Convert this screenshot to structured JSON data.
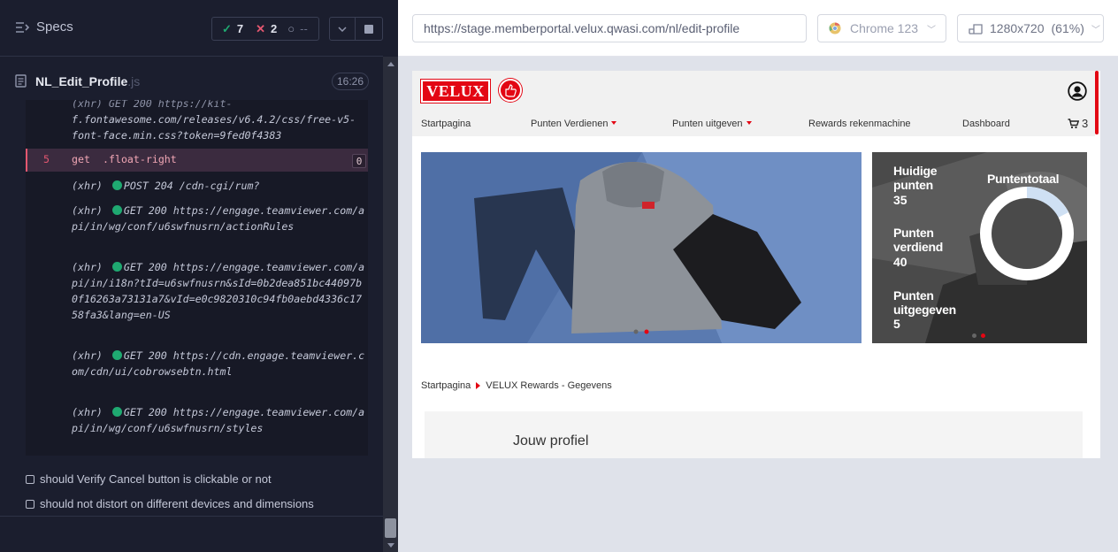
{
  "runner": {
    "title": "Specs",
    "stats": {
      "passed": "7",
      "failed": "2",
      "pending": "--"
    },
    "file": {
      "name": "NL_Edit_Profile",
      "ext": ".js",
      "duration": "16:26"
    },
    "log": {
      "top_line": "(xhr)  GET 200 https://kit-",
      "top_url": "f.fontawesome.com/releases/v6.4.2/css/free-v5-font-face.min.css?token=9fed0f4383",
      "command": {
        "number": "5",
        "name": "get",
        "selector": ".float-right",
        "count": "0"
      },
      "requests": [
        {
          "tag": "(xhr)",
          "method": "POST 204",
          "url": "/cdn-cgi/rum?"
        },
        {
          "tag": "(xhr)",
          "method": "GET 200",
          "url": "https://engage.teamviewer.com/api/in/wg/conf/u6swfnusrn/actionRules"
        },
        {
          "tag": "(xhr)",
          "method": "GET 200",
          "url": "https://engage.teamviewer.com/api/in/i18n?tId=u6swfnusrn&sId=0b2dea851bc44097b0f16263a73131a7&vId=e0c9820310c94fb0aebd4336c1758fa3&lang=en-US"
        },
        {
          "tag": "(xhr)",
          "method": "GET 200",
          "url": "https://cdn.engage.teamviewer.com/cdn/ui/cobrowsebtn.html"
        },
        {
          "tag": "(xhr)",
          "method": "GET 200",
          "url": "https://engage.teamviewer.com/api/in/wg/conf/u6swfnusrn/styles"
        }
      ]
    },
    "tests": [
      "should Verify Cancel button is clickable or not",
      "should not distort on different devices and dimensions"
    ]
  },
  "toolbar": {
    "url": "https://stage.memberportal.velux.qwasi.com/nl/edit-profile",
    "browser": "Chrome 123",
    "viewport": "1280x720",
    "zoom": "(61%)"
  },
  "site": {
    "logo": "VELUX",
    "nav": [
      "Startpagina",
      "Punten Verdienen",
      "Punten uitgeven",
      "Rewards rekenmachine",
      "Dashboard"
    ],
    "cart_count": "3",
    "stats": {
      "current_label": "Huidige punten",
      "current_value": "35",
      "earned_label": "Punten verdiend",
      "earned_value": "40",
      "spent_label": "Punten uitgegeven",
      "spent_value": "5",
      "total_label": "Puntentotaal"
    },
    "breadcrumb": {
      "home": "Startpagina",
      "current": "VELUX Rewards - Gegevens"
    },
    "profile_title": "Jouw profiel",
    "colors": {
      "brand": "#e30613"
    }
  }
}
